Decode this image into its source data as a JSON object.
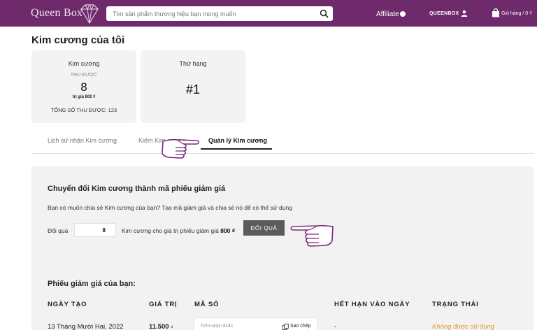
{
  "header": {
    "logo_text": "Queen Box",
    "search_placeholder": "Tìm sản phẩm thương hiệu bạn mong muốn",
    "affiliate_label": "Affiliate",
    "user_label": "QUEENBOX",
    "cart_label": "Giỏ hàng / 0 ₫",
    "brand_color": "#6e2a6b",
    "icons": [
      "gem-logo-icon",
      "search-icon",
      "user-icon",
      "shopping-bag-icon"
    ]
  },
  "page": {
    "title": "Kim cương của tôi"
  },
  "stats": {
    "diamond": {
      "label": "Kim cương",
      "sublabel": "THU ĐƯỢC",
      "value": "8",
      "worth": "trị giá 800 ₫",
      "total": "TỔNG SỐ THU ĐƯỢC: 123"
    },
    "rank": {
      "label": "Thứ hạng",
      "value": "#1"
    }
  },
  "tabs": [
    {
      "label": "Lịch sử nhận Kim cương",
      "active": false
    },
    {
      "label": "Kiếm Kim cương",
      "active": false
    },
    {
      "label": "Quản lý Kim cương",
      "active": true
    }
  ],
  "exchange": {
    "title": "Chuyển đổi Kim cương thành mã phiếu giảm giá",
    "description": "Bạn có muốn chia sẻ Kim cương của bạn? Tạo mã giảm giá và chia sẻ nó để có thể sử dụng",
    "label": "Đổi quà",
    "input_value": "8",
    "text_before": "Kim cương cho giá trị phiếu giảm giá",
    "text_amount": "800 ₫",
    "button_label": "ĐỔI QUÀ"
  },
  "vouchers": {
    "title": "Phiếu giảm giá của bạn:",
    "columns": [
      "NGÀY TẠO",
      "GIÁ TRỊ",
      "MÃ SỐ",
      "HẾT HẠN VÀO NGÀY",
      "TRẠNG THÁI"
    ],
    "rows": [
      {
        "date": "13 Tháng Mười Hai, 2022",
        "value": "11.500",
        "currency": "₫",
        "code": "h7m-unjz-314c",
        "copy_label": "Sao chép",
        "expiry": "-",
        "status": "Không được sử dụng"
      }
    ],
    "status_color": "#e09a2b"
  }
}
